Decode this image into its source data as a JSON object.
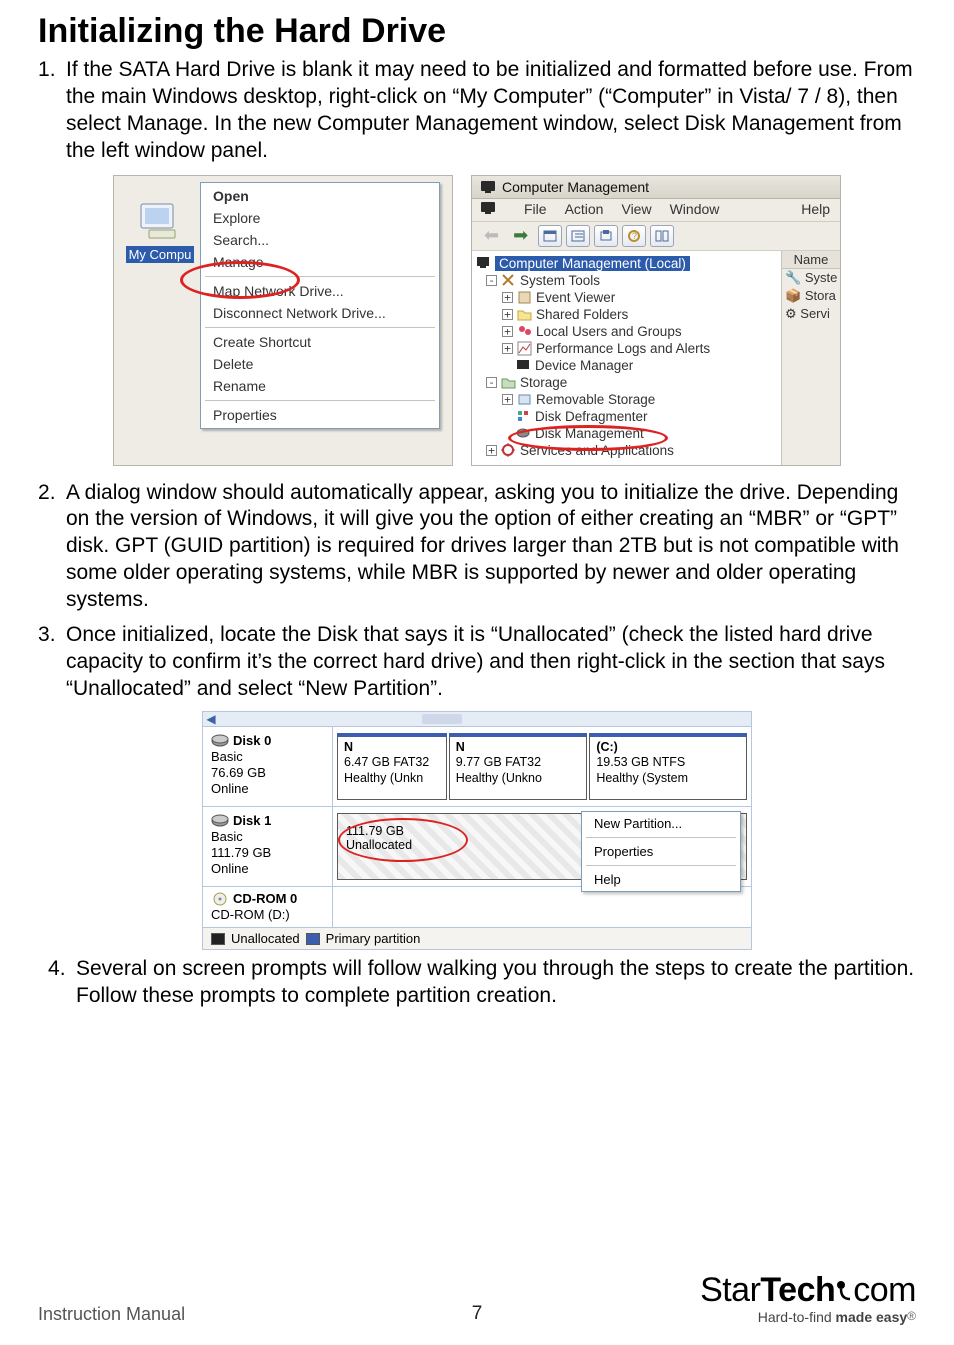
{
  "title": "Initializing the Hard Drive",
  "steps": [
    "If the SATA Hard Drive is blank it may need to be initialized and formatted before use. From the main Windows desktop, right-click on “My Computer” (“Computer” in Vista/ 7 / 8), then select Manage. In the new Computer Management window, select Disk Management from the left window panel.",
    "A dialog window should automatically appear, asking you to initialize the drive. Depending on the version of Windows, it will give you the option of either creating an “MBR” or “GPT” disk. GPT (GUID partition) is required for drives larger than 2TB but is not compatible with some older operating systems, while MBR is supported by newer and older operating systems.",
    "Once initialized, locate the Disk that says it is “Unallocated” (check the listed hard drive capacity to confirm it’s the correct hard drive) and then right-click in the section that says “Unallocated” and select “New Partition”.",
    "Several on screen prompts will follow walking you through the steps to create the partition.  Follow these prompts to complete partition creation."
  ],
  "fig1": {
    "icon_label": "My Compu",
    "ctx": {
      "open": "Open",
      "explore": "Explore",
      "search": "Search...",
      "manage": "Manage",
      "map": "Map Network Drive...",
      "disconnect": "Disconnect Network Drive...",
      "shortcut": "Create Shortcut",
      "delete": "Delete",
      "rename": "Rename",
      "properties": "Properties"
    },
    "mgmt": {
      "title": "Computer Management",
      "menu": {
        "file": "File",
        "action": "Action",
        "view": "View",
        "window": "Window",
        "help": "Help"
      },
      "tree": {
        "root": "Computer Management (Local)",
        "systools": "System Tools",
        "event": "Event Viewer",
        "shared": "Shared Folders",
        "users": "Local Users and Groups",
        "perf": "Performance Logs and Alerts",
        "devmgr": "Device Manager",
        "storage": "Storage",
        "remov": "Removable Storage",
        "defrag": "Disk Defragmenter",
        "diskm": "Disk Management",
        "services": "Services and Applications"
      },
      "rcol": {
        "hdr": "Name",
        "r1": "Syste",
        "r2": "Stora",
        "r3": "Servi"
      }
    }
  },
  "fig2": {
    "disk0": {
      "name": "Disk 0",
      "type": "Basic",
      "size": "76.69 GB",
      "status": "Online"
    },
    "disk0_vols": [
      {
        "n": "N",
        "l2": "6.47 GB FAT32",
        "l3": "Healthy (Unkn"
      },
      {
        "n": "N",
        "l2": "9.77 GB FAT32",
        "l3": "Healthy (Unkno"
      },
      {
        "n": "(C:)",
        "l2": "19.53 GB NTFS",
        "l3": "Healthy (System"
      }
    ],
    "disk1": {
      "name": "Disk 1",
      "type": "Basic",
      "size": "111.79 GB",
      "status": "Online"
    },
    "disk1_unalloc": {
      "size": "111.79 GB",
      "label": "Unallocated"
    },
    "ctx2": {
      "np": "New Partition...",
      "props": "Properties",
      "help": "Help"
    },
    "cdrom": {
      "name": "CD-ROM 0",
      "sub": "CD-ROM (D:)"
    },
    "legend": {
      "u": "Unallocated",
      "p": "Primary partition"
    }
  },
  "footer": {
    "manual": "Instruction Manual",
    "page": "7",
    "logo1": "Star",
    "logo2": "Tech",
    "logo3": "com",
    "tag1": "Hard-to-find ",
    "tag2": "made easy",
    "reg": "®"
  }
}
